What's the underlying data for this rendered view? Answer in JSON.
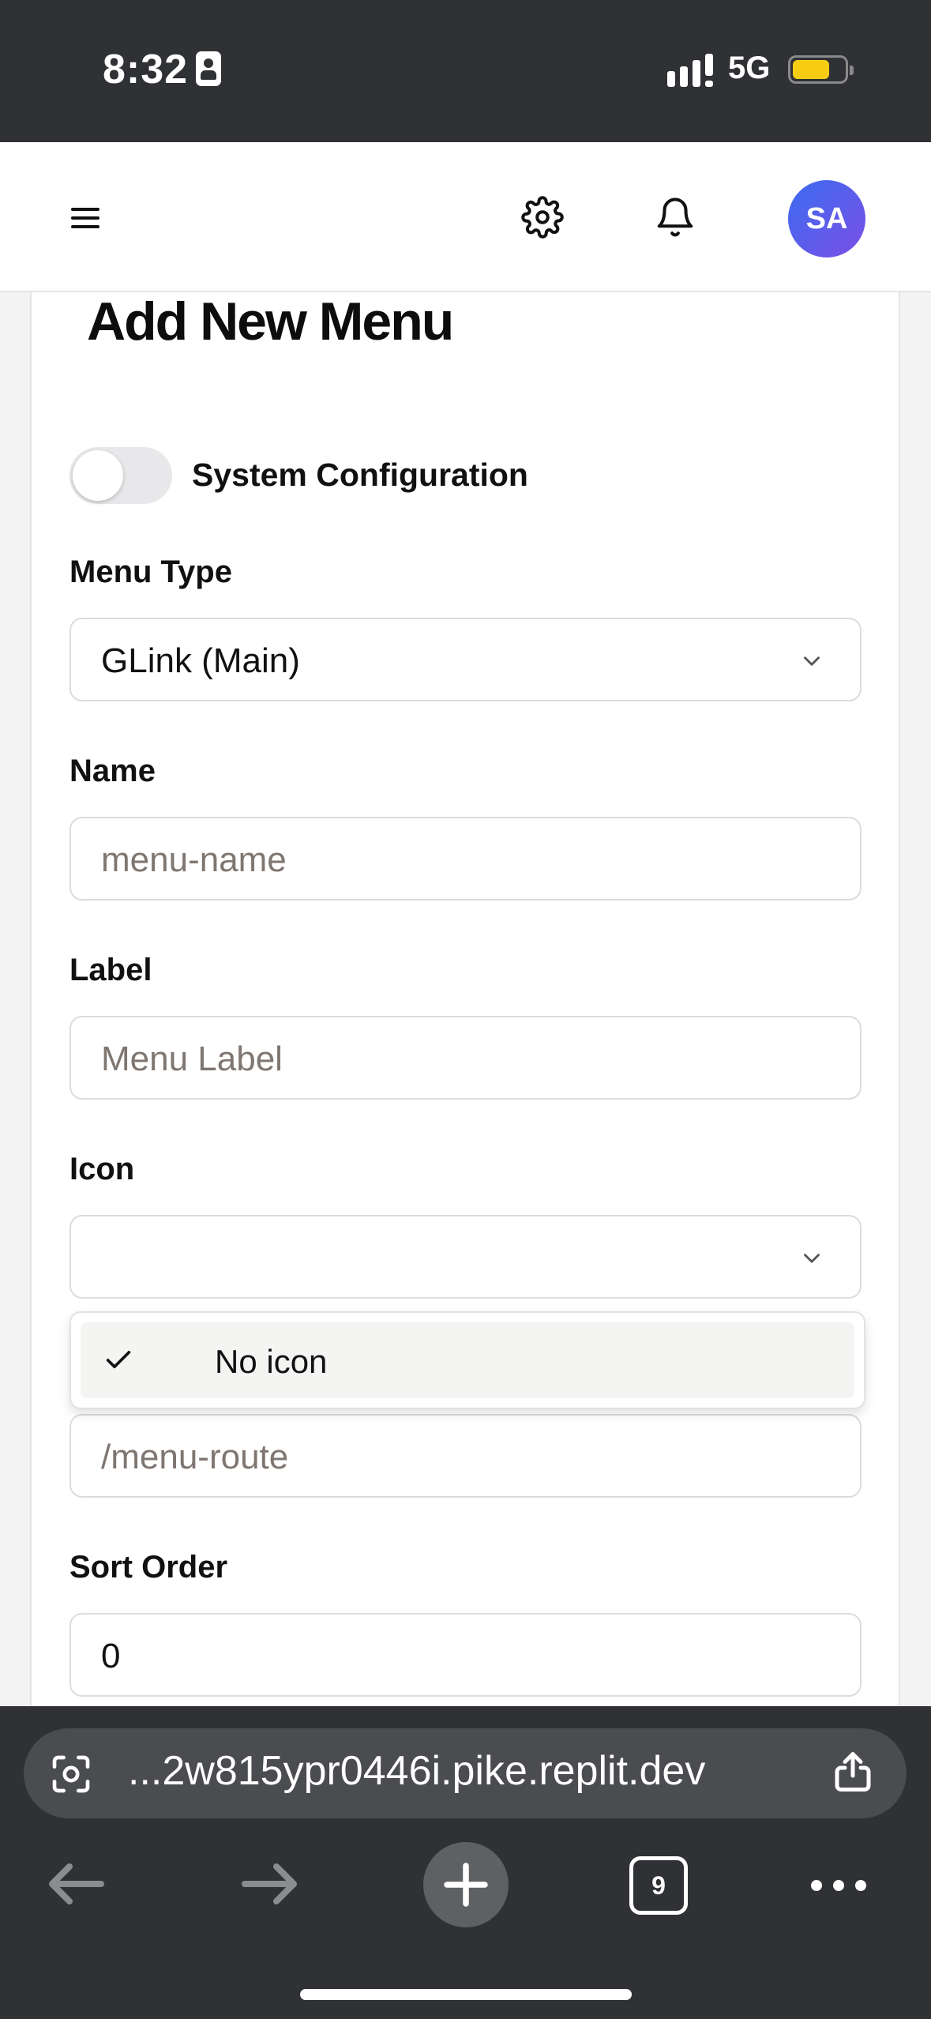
{
  "status_bar": {
    "time": "8:32",
    "network": "5G"
  },
  "header": {
    "avatar_initials": "SA"
  },
  "page": {
    "title": "Add New Menu"
  },
  "form": {
    "system_config_label": "System Configuration",
    "system_config_enabled": false,
    "menu_type": {
      "label": "Menu Type",
      "value": "GLink (Main)"
    },
    "name": {
      "label": "Name",
      "placeholder": "menu-name"
    },
    "label_field": {
      "label": "Label",
      "placeholder": "Menu Label"
    },
    "icon": {
      "label": "Icon",
      "value": ""
    },
    "icon_dropdown": {
      "options": [
        {
          "label": "No icon",
          "selected": true
        }
      ]
    },
    "route": {
      "placeholder": "/menu-route"
    },
    "sort_order": {
      "label": "Sort Order",
      "value": "0"
    }
  },
  "browser": {
    "url": "...2w815ypr0446i.pike.replit.dev",
    "tab_count": "9"
  },
  "colors": {
    "avatar_from": "#3b6cf0",
    "avatar_to": "#7b4fe6",
    "battery": "#f7cd12",
    "chrome_bg": "#2f3134"
  }
}
